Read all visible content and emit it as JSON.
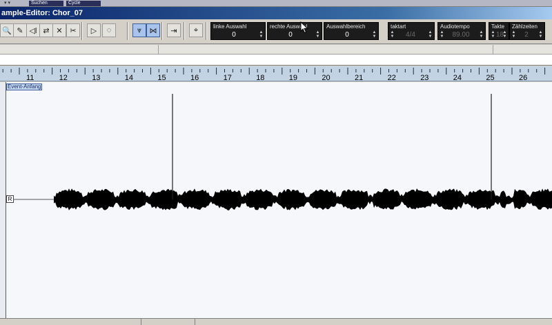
{
  "window": {
    "title": "ample-Editor: Chor_07"
  },
  "top_tabs": {
    "left": "Suchen",
    "right": "Cycle"
  },
  "toolbar": {
    "tools": [
      {
        "name": "zoom-tool",
        "glyph": "🔍",
        "active": false
      },
      {
        "name": "pencil-tool",
        "glyph": "✎",
        "active": false
      },
      {
        "name": "speaker-tool",
        "glyph": "◁ǀ",
        "active": false
      },
      {
        "name": "time-warp-tool",
        "glyph": "⇄",
        "active": false
      },
      {
        "name": "hitpoint-tool",
        "glyph": "✕",
        "active": false
      },
      {
        "name": "scissors-tool",
        "glyph": "✂",
        "active": false
      },
      {
        "name": "play-button",
        "glyph": "▷",
        "active": false
      },
      {
        "name": "loop-button",
        "glyph": "◌",
        "active": false
      },
      {
        "name": "snap-view-button",
        "glyph": "⩔",
        "active": true
      },
      {
        "name": "zero-crossing-button",
        "glyph": "⋈",
        "active": true
      },
      {
        "name": "autoscroll-button",
        "glyph": "⇥",
        "active": false
      },
      {
        "name": "cursor-follow-button",
        "glyph": "⌖",
        "active": false
      }
    ],
    "fields": [
      {
        "key": "left-selection",
        "label": "linke Auswahl",
        "value": "0",
        "dim": false
      },
      {
        "key": "right-selection",
        "label": "rechte Auswahl",
        "value": "0",
        "dim": false
      },
      {
        "key": "selection-range",
        "label": "Auswahlbereich",
        "value": "0",
        "dim": false
      },
      {
        "key": "time-signature",
        "label": "taktart",
        "value": "4/4",
        "dim": true
      },
      {
        "key": "audio-tempo",
        "label": "Audiotempo",
        "value": "89.00",
        "dim": true
      },
      {
        "key": "bars",
        "label": "Takte",
        "value": "18",
        "dim": true
      },
      {
        "key": "beats",
        "label": "Zählzeiten",
        "value": "2",
        "dim": true
      }
    ]
  },
  "ruler": {
    "first_bar": 11,
    "labels": [
      "11",
      "12",
      "13",
      "14",
      "15",
      "16",
      "17",
      "18",
      "19",
      "20",
      "21",
      "22",
      "23",
      "24",
      "25",
      "26"
    ]
  },
  "canvas": {
    "event_start_label": "Event-Anfang",
    "channel_label": "R",
    "colors": {
      "background": "#f5f7fa",
      "waveform": "#000000",
      "ruler": "#c2d3e4"
    }
  }
}
